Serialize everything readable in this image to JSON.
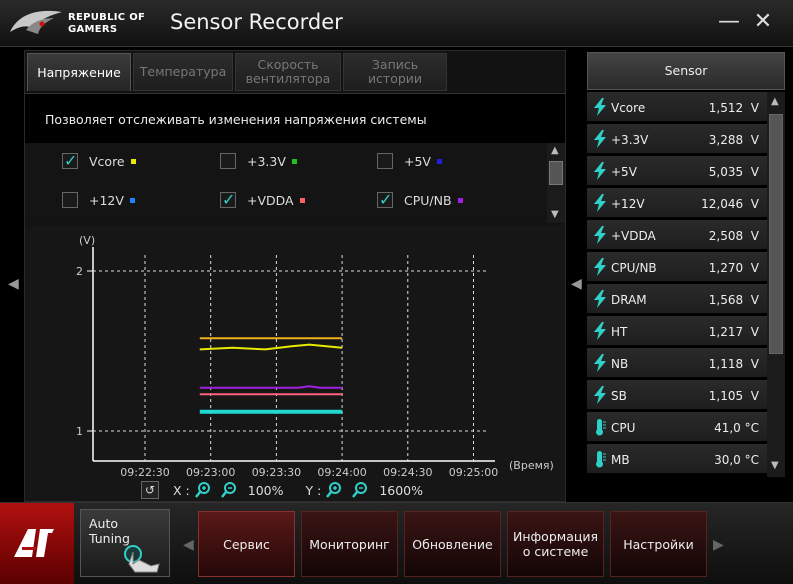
{
  "app": {
    "brand_line1": "REPUBLIC OF",
    "brand_line2": "GAMERS",
    "title": "Sensor Recorder"
  },
  "window": {
    "minimize": "—",
    "close": "✕"
  },
  "tabs": [
    {
      "label": "Напряжение",
      "active": true
    },
    {
      "label": "Температура",
      "active": false
    },
    {
      "label": "Скорость вентилятора",
      "active": false
    },
    {
      "label": "Запись истории",
      "active": false
    }
  ],
  "description": "Позволяет отслеживать изменения напряжения системы",
  "checkboxes": [
    {
      "label": "Vcore",
      "checked": true,
      "color": "#e8e800"
    },
    {
      "label": "+3.3V",
      "checked": false,
      "color": "#20c020"
    },
    {
      "label": "+5V",
      "checked": false,
      "color": "#2020e0"
    },
    {
      "label": "+12V",
      "checked": false,
      "color": "#2080ff"
    },
    {
      "label": "+VDDA",
      "checked": true,
      "color": "#ff6060"
    },
    {
      "label": "CPU/NB",
      "checked": true,
      "color": "#a020e0"
    }
  ],
  "chart_data": {
    "type": "line",
    "ylabel": "(V)",
    "xlabel": "(Время)",
    "yticks": [
      "2",
      "1"
    ],
    "ylim": [
      0.75,
      2.1
    ],
    "xticks": [
      "09:22:30",
      "09:23:00",
      "09:23:30",
      "09:24:00",
      "09:24:30",
      "09:25:00"
    ],
    "grid": true,
    "series": [
      {
        "color": "#f0b020",
        "x": [
          "09:22:55",
          "09:23:15",
          "09:23:35",
          "09:23:55",
          "09:24:00"
        ],
        "y": [
          1.58,
          1.58,
          1.58,
          1.58,
          1.58
        ]
      },
      {
        "color": "#e8e800",
        "x": [
          "09:22:55",
          "09:23:10",
          "09:23:25",
          "09:23:37",
          "09:23:45",
          "09:24:00"
        ],
        "y": [
          1.51,
          1.52,
          1.51,
          1.53,
          1.54,
          1.52
        ]
      },
      {
        "color": "#a020e0",
        "x": [
          "09:22:55",
          "09:23:20",
          "09:23:40",
          "09:23:45",
          "09:23:50",
          "09:24:00"
        ],
        "y": [
          1.27,
          1.27,
          1.27,
          1.28,
          1.27,
          1.27
        ]
      },
      {
        "color": "#ff6080",
        "x": [
          "09:22:55",
          "09:24:00"
        ],
        "y": [
          1.23,
          1.23
        ]
      },
      {
        "color": "#20d8d0",
        "x": [
          "09:22:55",
          "09:24:00"
        ],
        "y": [
          1.12,
          1.12
        ]
      }
    ]
  },
  "zoom": {
    "x_label": "X :",
    "x_value": "100%",
    "y_label": "Y :",
    "y_value": "1600%"
  },
  "sensor": {
    "header": "Sensor",
    "items": [
      {
        "name": "Vcore",
        "value": "1,512  V",
        "icon": "lightning-icon"
      },
      {
        "name": "+3.3V",
        "value": "3,288  V",
        "icon": "lightning-icon"
      },
      {
        "name": "+5V",
        "value": "5,035  V",
        "icon": "lightning-icon"
      },
      {
        "name": "+12V",
        "value": "12,046  V",
        "icon": "lightning-icon"
      },
      {
        "name": "+VDDA",
        "value": "2,508  V",
        "icon": "lightning-icon"
      },
      {
        "name": "CPU/NB",
        "value": "1,270  V",
        "icon": "lightning-icon"
      },
      {
        "name": "DRAM",
        "value": "1,568  V",
        "icon": "lightning-icon"
      },
      {
        "name": "HT",
        "value": "1,217  V",
        "icon": "lightning-icon"
      },
      {
        "name": "NB",
        "value": "1,118  V",
        "icon": "lightning-icon"
      },
      {
        "name": "SB",
        "value": "1,105  V",
        "icon": "lightning-icon"
      },
      {
        "name": "CPU",
        "value": "41,0 °C",
        "icon": "thermometer-icon"
      },
      {
        "name": "MB",
        "value": "30,0 °C",
        "icon": "thermometer-icon"
      }
    ]
  },
  "bottom": {
    "auto_tuning": "Auto Tuning",
    "nav": [
      {
        "label": "Сервис",
        "active": true
      },
      {
        "label": "Мониторинг",
        "active": false
      },
      {
        "label": "Обновление",
        "active": false
      },
      {
        "label": "Информация о системе",
        "active": false
      },
      {
        "label": "Настройки",
        "active": false
      }
    ]
  }
}
